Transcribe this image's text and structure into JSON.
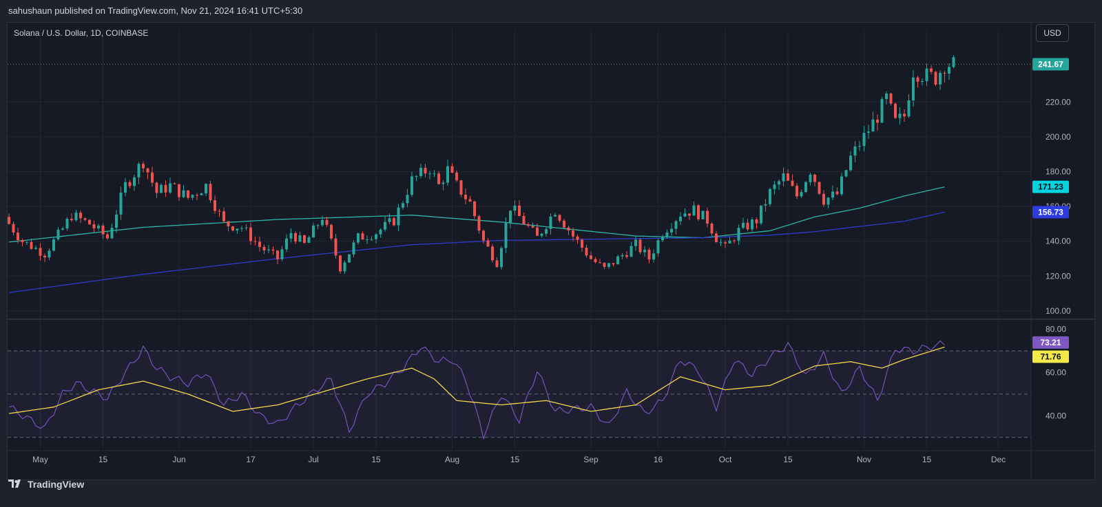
{
  "header": {
    "publish_line": "sahushaun published on TradingView.com, Nov 21, 2024 16:41 UTC+5:30"
  },
  "chart": {
    "title": "Solana / U.S. Dollar, 1D, COINBASE",
    "currency_button": "USD"
  },
  "footer": {
    "logo_text": "TradingView",
    "logo_icon": "tradingview-logo-icon"
  },
  "colors": {
    "up": "#26a69a",
    "down": "#ef5350",
    "ma_fast": "#2bb5a8",
    "ma_slow": "#2e3bc9",
    "rsi": "#7e57c2",
    "rsi_ma": "#f0d84a",
    "background": "#161a25",
    "grid": "#232734"
  },
  "chart_data": [
    {
      "type": "candlestick",
      "title": "Solana / U.S. Dollar, 1D, COINBASE",
      "x_range": [
        "2024-04-24",
        "2024-11-21"
      ],
      "xticks": [
        "May",
        "15",
        "Jun",
        "17",
        "Jul",
        "15",
        "Aug",
        "15",
        "Sep",
        "16",
        "Oct",
        "15",
        "Nov",
        "15",
        "Dec"
      ],
      "ylim": [
        96,
        262
      ],
      "yticks": [
        "100.00",
        "120.00",
        "140.00",
        "160.00",
        "180.00",
        "200.00",
        "220.00"
      ],
      "grid": true,
      "last_price": "241.67",
      "anchors": {
        "close_days": [
          0,
          3,
          8,
          12,
          14,
          18,
          22,
          26,
          30,
          33,
          36,
          40,
          44,
          48,
          52,
          56,
          60,
          63,
          66,
          70,
          74,
          78,
          82,
          86,
          90,
          94,
          96,
          98,
          100,
          103,
          106,
          109,
          112,
          116,
          118,
          122,
          126,
          130,
          133,
          137,
          140,
          143,
          146,
          150,
          153,
          156,
          158,
          160,
          163,
          167,
          170,
          173,
          176,
          179,
          182,
          185,
          188,
          191,
          194,
          196,
          198,
          200,
          202,
          205,
          207,
          209
        ],
        "close_values": [
          150,
          140,
          133,
          147,
          155,
          150,
          142,
          172,
          186,
          168,
          172,
          165,
          172,
          150,
          148,
          137,
          130,
          145,
          138,
          154,
          125,
          142,
          145,
          152,
          175,
          182,
          172,
          181,
          172,
          162,
          140,
          128,
          160,
          148,
          142,
          158,
          143,
          130,
          124,
          132,
          138,
          130,
          145,
          156,
          158,
          152,
          142,
          136,
          146,
          152,
          168,
          177,
          166,
          181,
          164,
          167,
          188,
          200,
          212,
          222,
          208,
          212,
          238,
          235,
          234,
          241.67
        ]
      },
      "series": [
        {
          "name": "",
          "type": "line",
          "x_days": [
            0,
            30,
            60,
            90,
            110,
            125,
            140,
            155,
            170,
            180,
            190,
            200,
            209
          ],
          "values": [
            139.5,
            148,
            152.5,
            155,
            151,
            147,
            143,
            142,
            146,
            154,
            159,
            166,
            171.23
          ],
          "label": "171.23"
        },
        {
          "name": "",
          "type": "line",
          "x_days": [
            0,
            30,
            60,
            90,
            110,
            125,
            140,
            155,
            170,
            180,
            190,
            200,
            209
          ],
          "values": [
            110.5,
            121,
            130,
            138,
            140.5,
            141,
            141.5,
            142,
            143.5,
            145.5,
            148.5,
            151.5,
            156.73
          ],
          "label": "156.73"
        }
      ]
    },
    {
      "type": "line",
      "title": "",
      "x_range": [
        "2024-04-24",
        "2024-11-21"
      ],
      "ylim": [
        24.5,
        84
      ],
      "yticks": [
        "40.00",
        "60.00",
        "80.00"
      ],
      "bands": [
        30,
        50,
        70
      ],
      "series": [
        {
          "name": "",
          "x_days": [
            0,
            4,
            8,
            12,
            15,
            18,
            22,
            26,
            30,
            33,
            36,
            40,
            44,
            48,
            52,
            56,
            60,
            64,
            68,
            72,
            76,
            80,
            84,
            88,
            92,
            96,
            99,
            102,
            106,
            110,
            114,
            118,
            122,
            126,
            130,
            134,
            138,
            142,
            146,
            150,
            154,
            158,
            162,
            166,
            170,
            174,
            178,
            182,
            186,
            190,
            194,
            198,
            202,
            206,
            209
          ],
          "values": [
            44,
            39,
            34,
            50,
            55,
            52,
            48,
            60,
            71,
            62,
            58,
            55,
            60,
            45,
            50,
            40,
            36,
            44,
            51,
            57,
            33,
            50,
            55,
            62,
            72,
            65,
            66,
            57,
            31,
            50,
            38,
            61,
            42,
            43,
            44,
            35,
            51,
            41,
            47,
            66,
            61,
            44,
            66,
            59,
            67,
            73,
            58,
            68,
            50,
            62,
            47,
            71,
            70,
            72,
            73.21
          ],
          "label": "73.21"
        },
        {
          "name": "",
          "x_days": [
            0,
            10,
            20,
            30,
            40,
            50,
            60,
            70,
            80,
            90,
            95,
            100,
            110,
            120,
            130,
            140,
            150,
            160,
            170,
            180,
            188,
            195,
            200,
            209
          ],
          "values": [
            41,
            44,
            52,
            56,
            50,
            42,
            45,
            51,
            57,
            62,
            57,
            47,
            45,
            47,
            42,
            45,
            58,
            52,
            54,
            63,
            65,
            62,
            66,
            71.76
          ],
          "label": "71.76"
        }
      ]
    }
  ]
}
